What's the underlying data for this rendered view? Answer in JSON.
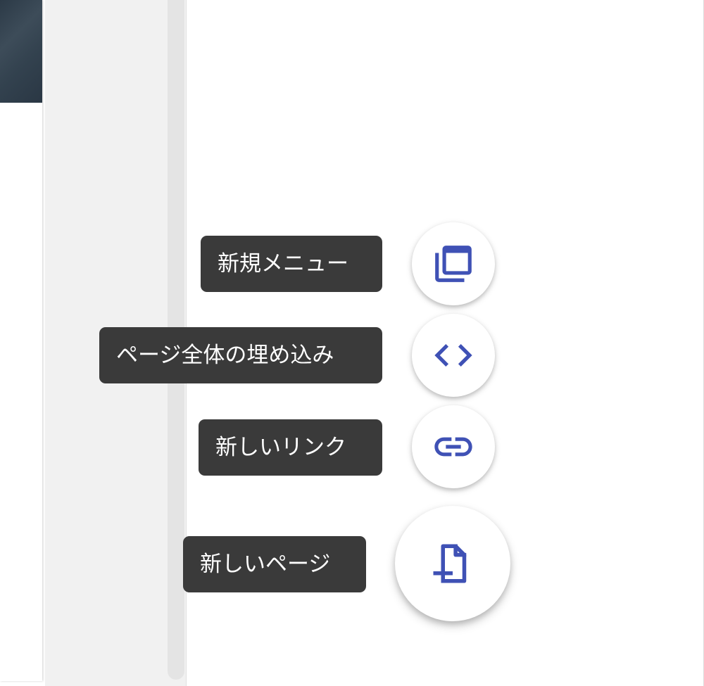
{
  "speed_dial": {
    "accent_color": "#3f51b5",
    "actions": [
      {
        "label": "新規メニュー",
        "icon": "copy-window-icon"
      },
      {
        "label": "ページ全体の埋め込み",
        "icon": "code-icon"
      },
      {
        "label": "新しいリンク",
        "icon": "link-icon"
      },
      {
        "label": "新しいページ",
        "icon": "add-page-icon"
      }
    ]
  }
}
